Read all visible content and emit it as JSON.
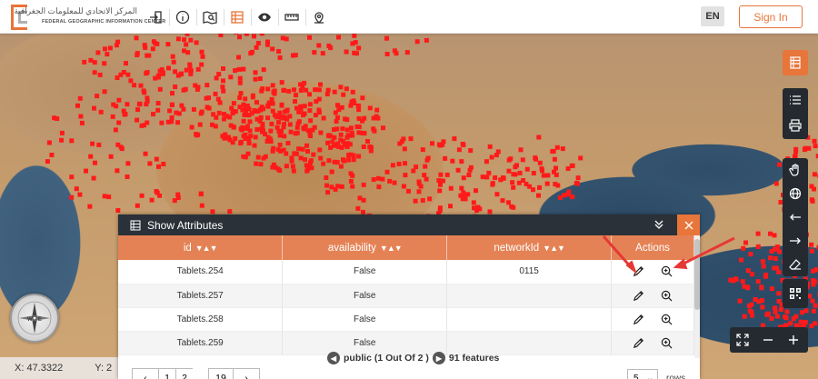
{
  "header": {
    "logo_ar": "المركز الاتحادي للمعلومات الجغرافية",
    "logo_en": "FEDERAL GEOGRAPHIC INFORMATION CENTER",
    "tools": [
      "login-icon",
      "info-icon",
      "map-search-icon",
      "table-icon",
      "eye-icon",
      "ruler-icon",
      "location-pin-icon"
    ],
    "lang": "EN",
    "signin": "Sign In",
    "accent": "#e8753a"
  },
  "status": {
    "x_label": "X: 47.3322",
    "y_label": "Y: 2"
  },
  "attributes_panel": {
    "title": "Show Attributes",
    "columns": [
      "id",
      "availability",
      "networkId",
      "Actions"
    ],
    "rows": [
      {
        "id": "Tablets.254",
        "availability": "False",
        "networkId": "0115"
      },
      {
        "id": "Tablets.257",
        "availability": "False",
        "networkId": ""
      },
      {
        "id": "Tablets.258",
        "availability": "False",
        "networkId": ""
      },
      {
        "id": "Tablets.259",
        "availability": "False",
        "networkId": ""
      }
    ],
    "pager_text": "public (1 Out Of 2 )",
    "features_text": "91 features",
    "paginator": {
      "prev": "‹",
      "page1": "1",
      "page2": "2",
      "dots": "...",
      "last": "19",
      "next": "›"
    },
    "rows_value": "5",
    "rows_label": "rows"
  }
}
